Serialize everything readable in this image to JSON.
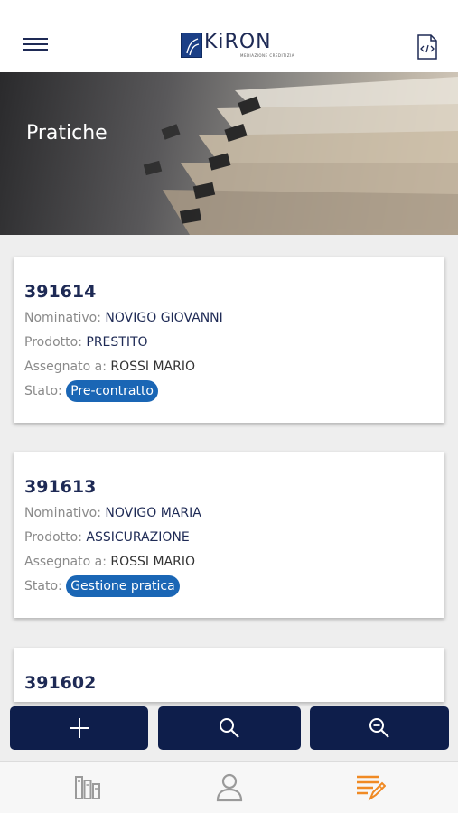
{
  "header": {
    "logo_name": "KiRON",
    "logo_tagline": "MEDIAZIONE CREDITIZIA"
  },
  "banner": {
    "title": "Pratiche"
  },
  "labels": {
    "nominativo": "Nominativo:",
    "prodotto": "Prodotto:",
    "assegnato": "Assegnato a:",
    "stato": "Stato:"
  },
  "cards": [
    {
      "id": "391614",
      "nominativo": "NOVIGO GIOVANNI",
      "prodotto": "PRESTITO",
      "assegnato": "ROSSI MARIO",
      "stato": "Pre-contratto"
    },
    {
      "id": "391613",
      "nominativo": "NOVIGO MARIA",
      "prodotto": "ASSICURAZIONE",
      "assegnato": "ROSSI MARIO",
      "stato": "Gestione pratica"
    },
    {
      "id": "391602"
    }
  ],
  "colors": {
    "navy": "#0e1e4b",
    "badge_blue": "#1a66b5",
    "active_tab": "#f08a24",
    "inactive_tab": "#9a9a9a"
  },
  "icons": {
    "menu": "hamburger-menu-icon",
    "code": "code-document-icon",
    "add": "plus-icon",
    "search": "search-icon",
    "zoom_out": "zoom-out-icon",
    "dashboard": "dashboard-icon",
    "profile": "user-icon",
    "pratiche": "edit-list-icon"
  }
}
